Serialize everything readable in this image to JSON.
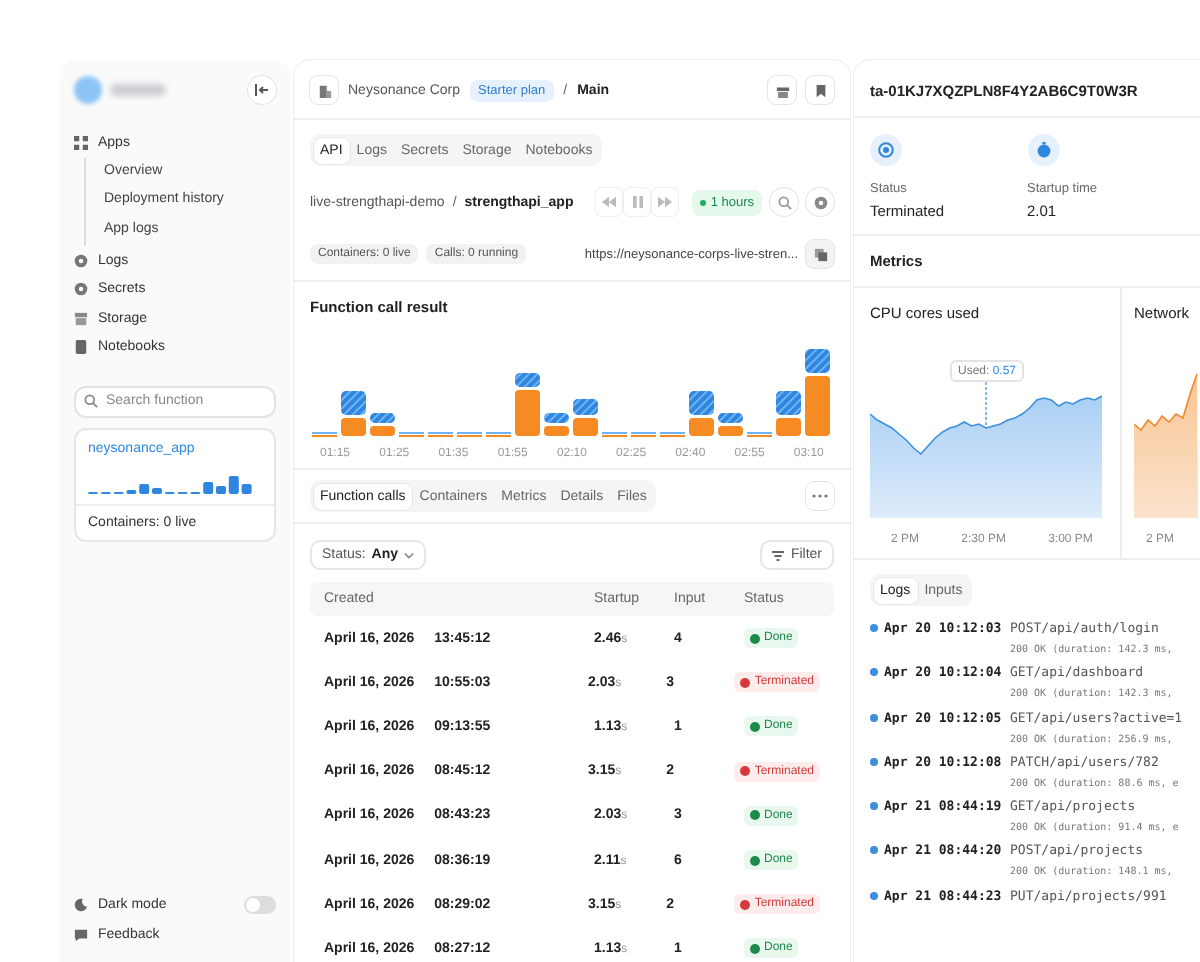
{
  "sidebar": {
    "nav": [
      {
        "label": "Apps",
        "children": [
          {
            "label": "Overview"
          },
          {
            "label": "Deployment history"
          },
          {
            "label": "App logs"
          }
        ]
      },
      {
        "label": "Logs"
      },
      {
        "label": "Secrets"
      },
      {
        "label": "Storage"
      },
      {
        "label": "Notebooks"
      }
    ],
    "search": {
      "placeholder": "Search function"
    },
    "app_card": {
      "name": "neysonance_app",
      "containers": "Containers: 0 live"
    },
    "dark_mode": {
      "label": "Dark mode",
      "on": false
    },
    "feedback": "Feedback"
  },
  "main": {
    "breadcrumb": {
      "org": "Neysonance Corp",
      "plan": "Starter plan",
      "separator": "/",
      "env": "Main"
    },
    "tabs": [
      {
        "label": "API",
        "selected": true
      },
      {
        "label": "Logs",
        "selected": false
      },
      {
        "label": "Secrets",
        "selected": false
      },
      {
        "label": "Storage",
        "selected": false
      },
      {
        "label": "Notebooks",
        "selected": false
      }
    ],
    "path": {
      "workspace": "live-strengthapi-demo",
      "separator": "/",
      "app": "strengthapi_app"
    },
    "time_range": "1 hours",
    "chips": [
      "Containers: 0 live",
      "Calls: 0 running"
    ],
    "url": "https://neysonance-corps-live-stren...",
    "chart": {
      "title": "Function call result",
      "x_labels": [
        "01:15",
        "01:25",
        "01:35",
        "01:55",
        "02:10",
        "02:25",
        "02:40",
        "02:55",
        "03:10"
      ]
    },
    "subtabs": [
      {
        "label": "Function calls",
        "selected": true
      },
      {
        "label": "Containers",
        "selected": false
      },
      {
        "label": "Metrics",
        "selected": false
      },
      {
        "label": "Details",
        "selected": false
      },
      {
        "label": "Files",
        "selected": false
      }
    ],
    "status_filter": {
      "label": "Status:",
      "value": "Any"
    },
    "filter_button": "Filter",
    "table": {
      "columns": [
        "Created",
        "Startup",
        "Input",
        "Status"
      ],
      "rows": [
        {
          "date": "April 16, 2026",
          "time": "13:45:12",
          "startup": "2.46",
          "unit": "s",
          "input": "4",
          "status": "Done",
          "kind": "done"
        },
        {
          "date": "April 16, 2026",
          "time": "10:55:03",
          "startup": "2.03",
          "unit": "s",
          "input": "3",
          "status": "Terminated",
          "kind": "terminated"
        },
        {
          "date": "April 16, 2026",
          "time": "09:13:55",
          "startup": "1.13",
          "unit": "s",
          "input": "1",
          "status": "Done",
          "kind": "done"
        },
        {
          "date": "April 16, 2026",
          "time": "08:45:12",
          "startup": "3.15",
          "unit": "s",
          "input": "2",
          "status": "Terminated",
          "kind": "terminated"
        },
        {
          "date": "April 16, 2026",
          "time": "08:43:23",
          "startup": "2.03",
          "unit": "s",
          "input": "3",
          "status": "Done",
          "kind": "done"
        },
        {
          "date": "April 16, 2026",
          "time": "08:36:19",
          "startup": "2.11",
          "unit": "s",
          "input": "6",
          "status": "Done",
          "kind": "done"
        },
        {
          "date": "April 16, 2026",
          "time": "08:29:02",
          "startup": "3.15",
          "unit": "s",
          "input": "2",
          "status": "Terminated",
          "kind": "terminated"
        },
        {
          "date": "April 16, 2026",
          "time": "08:27:12",
          "startup": "1.13",
          "unit": "s",
          "input": "1",
          "status": "Done",
          "kind": "done"
        }
      ]
    }
  },
  "detail": {
    "id": "ta-01KJ7XQZPLN8F4Y2AB6C9T0W3R",
    "stats": [
      {
        "label": "Status",
        "value": "Terminated"
      },
      {
        "label": "Startup time",
        "value": "2.01"
      }
    ],
    "metrics_title": "Metrics",
    "cpu_chart": {
      "title": "CPU cores used",
      "tooltip_label": "Used:",
      "tooltip_value": "0.57",
      "x_labels": [
        "2 PM",
        "2:30 PM",
        "3:00 PM"
      ]
    },
    "network_chart": {
      "title": "Network",
      "x_labels": [
        "2 PM"
      ]
    },
    "log_tabs": [
      {
        "label": "Logs",
        "selected": true
      },
      {
        "label": "Inputs",
        "selected": false
      }
    ],
    "logs": [
      {
        "time": "Apr 20 10:12:03",
        "request": "POST/api/auth/login",
        "detail": "200 OK (duration: 142.3 ms,"
      },
      {
        "time": "Apr 20 10:12:04",
        "request": "GET/api/dashboard",
        "detail": "200 OK (duration: 142.3 ms,"
      },
      {
        "time": "Apr 20 10:12:05",
        "request": "GET/api/users?active=1",
        "detail": "200 OK (duration: 256.9 ms,"
      },
      {
        "time": "Apr 20 10:12:08",
        "request": "PATCH/api/users/782",
        "detail": "200 OK (duration: 88.6 ms, e"
      },
      {
        "time": "Apr 21 08:44:19",
        "request": "GET/api/projects",
        "detail": "200 OK (duration: 91.4 ms, e"
      },
      {
        "time": "Apr 21 08:44:20",
        "request": "POST/api/projects",
        "detail": "200 OK (duration: 148.1 ms,"
      },
      {
        "time": "Apr 21 08:44:23",
        "request": "PUT/api/projects/991"
      }
    ]
  }
}
